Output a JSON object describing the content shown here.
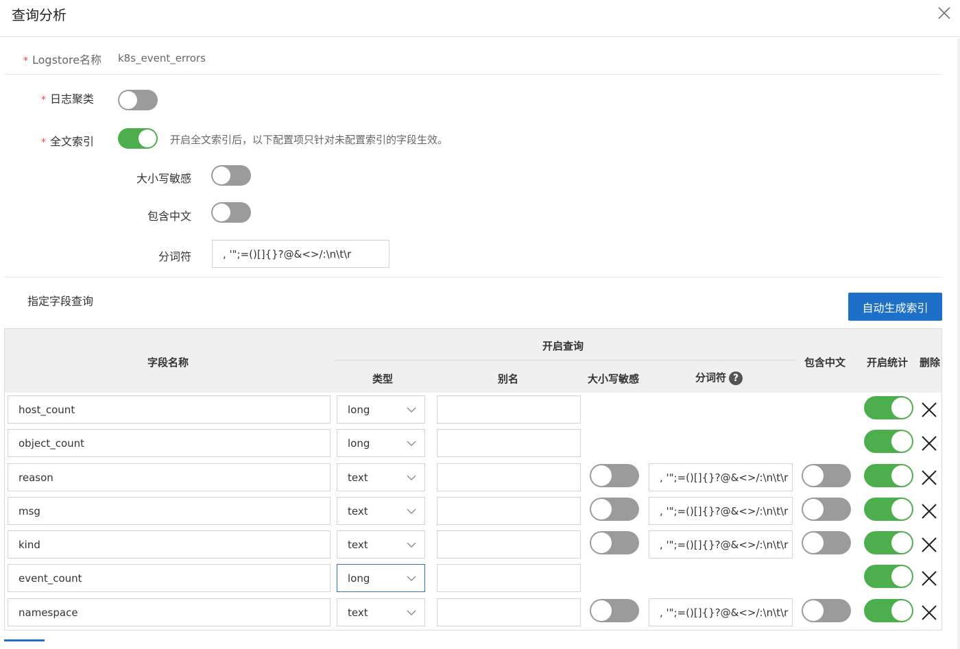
{
  "dialog": {
    "title": "查询分析"
  },
  "form": {
    "logstore_label": "Logstore名称",
    "logstore_value": "k8s_event_errors",
    "log_cluster_label": "日志聚类",
    "fulltext_label": "全文索引",
    "fulltext_hint": "开启全文索引后，以下配置项只针对未配置索引的字段生效。",
    "case_label": "大小写敏感",
    "chinese_label": "包含中文",
    "tokenizer_label": "分词符",
    "tokenizer_value": ", '\";=()[]{}?@&<>/:\\n\\t\\r",
    "required_mark": "*",
    "log_cluster_on": false,
    "fulltext_on": true,
    "case_on": false,
    "chinese_on": false
  },
  "fields": {
    "section_label": "指定字段查询",
    "auto_button": "自动生成索引",
    "headers": {
      "field_name": "字段名称",
      "enable_query": "开启查询",
      "type": "类型",
      "alias": "别名",
      "case": "大小写敏感",
      "tokenizer": "分词符",
      "help": "?",
      "chinese": "包含中文",
      "stats": "开启统计",
      "delete": "删除"
    },
    "rows": [
      {
        "name": "host_count",
        "type": "long",
        "alias": "",
        "tokenizer": "",
        "stats": true
      },
      {
        "name": "object_count",
        "type": "long",
        "alias": "",
        "tokenizer": "",
        "stats": true
      },
      {
        "name": "reason",
        "type": "text",
        "alias": "",
        "tokenizer": ", '\";=()[]{}?@&<>/:\\n\\t\\r",
        "case": false,
        "chinese": false,
        "stats": true
      },
      {
        "name": "msg",
        "type": "text",
        "alias": "",
        "tokenizer": ", '\";=()[]{}?@&<>/:\\n\\t\\r",
        "case": false,
        "chinese": false,
        "stats": true
      },
      {
        "name": "kind",
        "type": "text",
        "alias": "",
        "tokenizer": ", '\";=()[]{}?@&<>/:\\n\\t\\r",
        "case": false,
        "chinese": false,
        "stats": true
      },
      {
        "name": "event_count",
        "type": "long",
        "alias": "",
        "tokenizer": "",
        "stats": true
      },
      {
        "name": "namespace",
        "type": "text",
        "alias": "",
        "tokenizer": ", '\";=()[]{}?@&<>/:\\n\\t\\r",
        "case": false,
        "chinese": false,
        "stats": true
      }
    ]
  },
  "colors": {
    "accent": "#1e6fc8",
    "switch_on": "#4cae4c",
    "switch_off": "#9b9b9b",
    "required": "#e64545"
  }
}
